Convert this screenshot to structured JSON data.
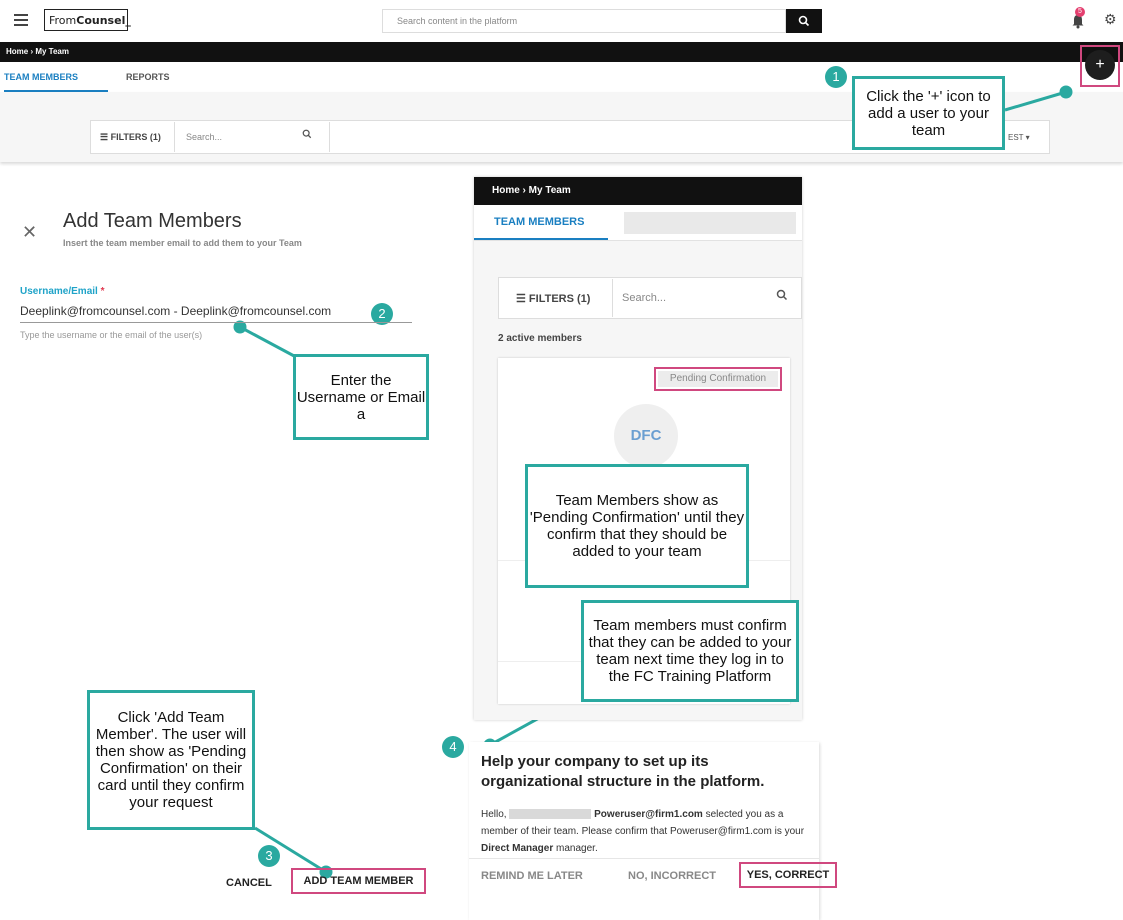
{
  "header": {
    "logo_prefix": "From",
    "logo_bold": "Counsel_",
    "search_placeholder": "Search content in the platform",
    "notification_count": "5"
  },
  "breadcrumb": "Home  ›  My Team",
  "tabs": [
    "TEAM MEMBERS",
    "REPORTS"
  ],
  "filters": {
    "label": "FILTERS (1)",
    "search_placeholder": "Search...",
    "sort_fragment": "EST"
  },
  "callouts": {
    "c1": "Click the '+' icon to add a user to your team",
    "c2": "Enter the Username or Email a",
    "c3": "Click 'Add Team Member'. The user will then show as 'Pending Confirmation' on their card until they confirm your request",
    "c_pending": "Team Members show as 'Pending Confirmation' until they confirm that they should be added to your team",
    "c4": "Team members must confirm that they can be added to your team next time they log in to the FC Training Platform"
  },
  "numbers": [
    "1",
    "2",
    "3",
    "4"
  ],
  "form": {
    "title": "Add Team Members",
    "subtitle": "Insert the team member email to add them to your Team",
    "label": "Username/Email",
    "required_mark": "*",
    "value": "Deeplink@fromcounsel.com - Deeplink@fromcounsel.com",
    "help": "Type the username or the email of the user(s)",
    "cancel": "CANCEL",
    "add": "ADD TEAM MEMBER"
  },
  "panel": {
    "breadcrumb": "Home  ›  My Team",
    "tab": "TEAM MEMBERS",
    "filter_label": "FILTERS (1)",
    "search_placeholder": "Search...",
    "active_count": "2 active members",
    "pending": "Pending Confirmation",
    "initials": "DFC"
  },
  "notification": {
    "title": "Help your company to set up its organizational structure in the platform.",
    "hello": "Hello,",
    "email": "Poweruser@firm1.com",
    "text1": "selected you as a member of their team. Please confirm that",
    "email2": "Poweruser@firm1.com",
    "text2": "is your",
    "role": "Direct Manager",
    "text3": "manager.",
    "remind": "REMIND ME LATER",
    "no": "NO, INCORRECT",
    "yes": "YES, CORRECT"
  },
  "colors": {
    "accent": "#1a7fc1",
    "callout": "#2aa9a0",
    "highlight": "#d0487f",
    "badge": "#e43f6f"
  }
}
